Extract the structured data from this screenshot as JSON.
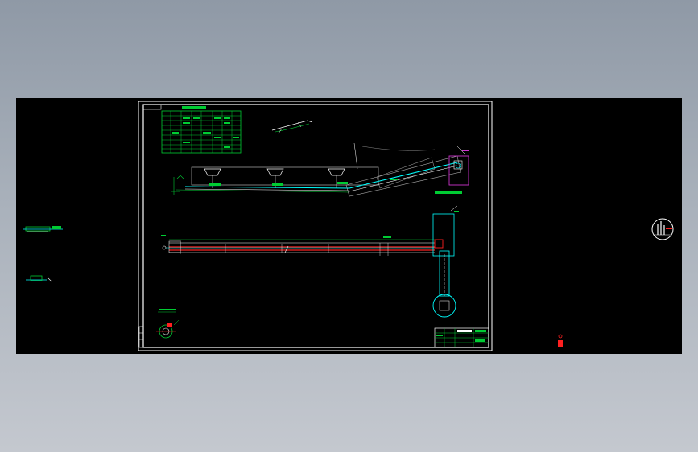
{
  "viewer": {
    "background_gradient": [
      "#8f99a6",
      "#c4c8cf"
    ],
    "canvas_color": "#000000"
  },
  "colors": {
    "frame": "#ffffff",
    "table": "#00cc33",
    "cyan": "#00ffff",
    "red": "#ff2020",
    "magenta": "#cc33cc",
    "green": "#33cc33",
    "gray": "#b0b0b0"
  },
  "icons": [
    "north-arrow-icon"
  ],
  "drawing_sheet": {
    "has_title_block": true,
    "has_parameter_table": true,
    "views": [
      "elevation-view",
      "plan-view",
      "detail-view",
      "pit-section"
    ]
  }
}
